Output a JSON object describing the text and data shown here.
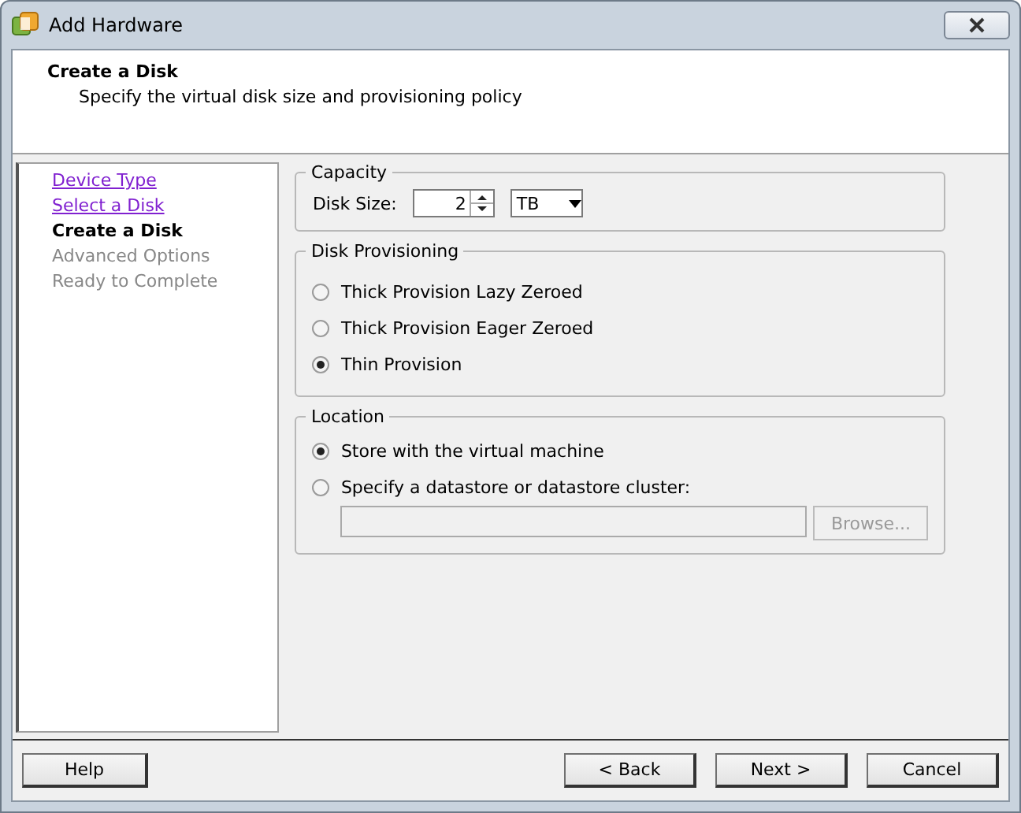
{
  "window": {
    "title": "Add Hardware"
  },
  "header": {
    "title": "Create a Disk",
    "subtitle": "Specify the virtual disk size and provisioning policy"
  },
  "steps": [
    {
      "label": "Device Type",
      "kind": "visited"
    },
    {
      "label": "Select a Disk",
      "kind": "visited"
    },
    {
      "label": "Create a Disk",
      "kind": "current"
    },
    {
      "label": "Advanced Options",
      "kind": "pending"
    },
    {
      "label": "Ready to Complete",
      "kind": "pending"
    }
  ],
  "capacity": {
    "legend": "Capacity",
    "label": "Disk Size:",
    "value": "2",
    "unit": "TB"
  },
  "provisioning": {
    "legend": "Disk Provisioning",
    "options": [
      {
        "label": "Thick Provision Lazy Zeroed",
        "selected": false
      },
      {
        "label": "Thick Provision Eager Zeroed",
        "selected": false
      },
      {
        "label": "Thin Provision",
        "selected": true
      }
    ]
  },
  "location": {
    "legend": "Location",
    "options": [
      {
        "label": "Store with the virtual machine",
        "selected": true
      },
      {
        "label": "Specify a datastore or datastore cluster:",
        "selected": false
      }
    ],
    "browse": {
      "label": "Browse...",
      "disabled": true
    }
  },
  "buttons": {
    "help": "Help",
    "back": "< Back",
    "next": "Next >",
    "cancel": "Cancel"
  }
}
